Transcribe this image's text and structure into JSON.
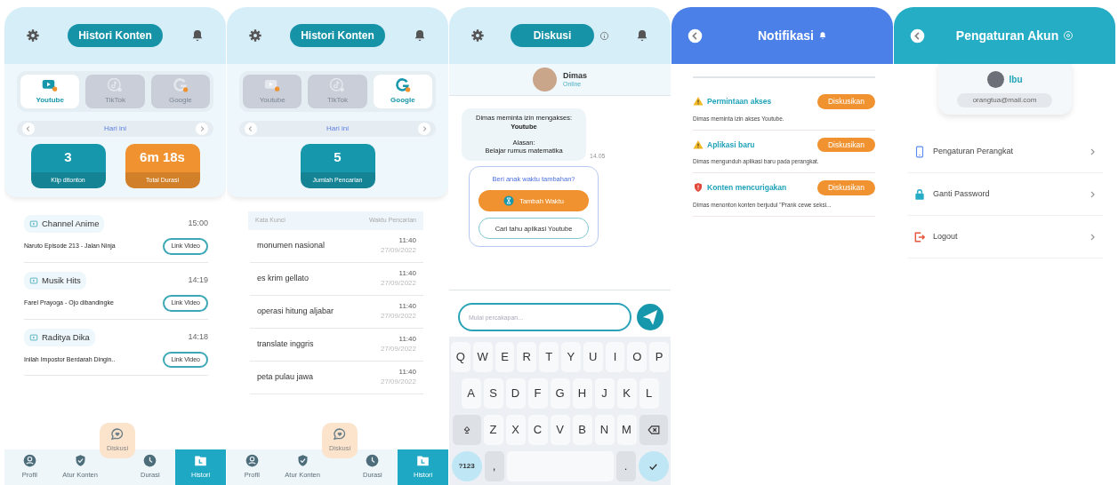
{
  "screens": [
    {
      "kind": "history",
      "title": "Histori Konten",
      "platforms": [
        {
          "label": "Youtube",
          "kind": "youtube",
          "selected": true
        },
        {
          "label": "TikTok",
          "kind": "tiktok",
          "selected": false
        },
        {
          "label": "Google",
          "kind": "google",
          "selected": false
        }
      ],
      "date_label": "Hari ini",
      "stats": [
        {
          "value": "3",
          "label": "Klip ditonton",
          "color": "#1797ab"
        },
        {
          "value": "6m 18s",
          "label": "Total Durasi",
          "color": "#f0922f"
        }
      ],
      "content": {
        "kind": "videos",
        "items": [
          {
            "channel": "Channel Anime",
            "time": "15:00",
            "title": "Naruto Episode 213 - Jalan Ninja",
            "button": "Link Video"
          },
          {
            "channel": "Musik Hits",
            "time": "14:19",
            "title": "Farel Prayoga - Ojo dibandingke",
            "button": "Link Video"
          },
          {
            "channel": "Raditya Dika",
            "time": "14:18",
            "title": "Inilah Impostor Berdarah Dingin..",
            "button": "Link Video"
          }
        ]
      },
      "fab_label": "Diskusi",
      "nav": [
        {
          "label": "Profil",
          "kind": "profile",
          "selected": false
        },
        {
          "label": "Atur Konten",
          "kind": "shield",
          "selected": false
        },
        {
          "label": "Durasi",
          "kind": "clock",
          "selected": false
        },
        {
          "label": "Histori",
          "kind": "folder",
          "selected": true
        }
      ]
    },
    {
      "kind": "history",
      "title": "Histori Konten",
      "platforms": [
        {
          "label": "Youtube",
          "kind": "youtube",
          "selected": false
        },
        {
          "label": "TikTok",
          "kind": "tiktok",
          "selected": false
        },
        {
          "label": "Google",
          "kind": "google",
          "selected": true
        }
      ],
      "date_label": "Hari ini",
      "stats": [
        {
          "value": "5",
          "label": "Jumlah Pencarian",
          "color": "#1797ab"
        }
      ],
      "content": {
        "kind": "searches",
        "columns": [
          "Kata Kunci",
          "Waktu Pencarian"
        ],
        "rows": [
          {
            "keyword": "monumen nasional",
            "time": "11:40",
            "date": "27/09/2022"
          },
          {
            "keyword": "es krim gellato",
            "time": "11:40",
            "date": "27/09/2022"
          },
          {
            "keyword": "operasi hitung aljabar",
            "time": "11:40",
            "date": "27/09/2022"
          },
          {
            "keyword": "translate inggris",
            "time": "11:40",
            "date": "27/09/2022"
          },
          {
            "keyword": "peta pulau jawa",
            "time": "11:40",
            "date": "27/09/2022"
          }
        ]
      },
      "fab_label": "Diskusi",
      "nav": [
        {
          "label": "Profil",
          "kind": "profile",
          "selected": false
        },
        {
          "label": "Atur Konten",
          "kind": "shield",
          "selected": false
        },
        {
          "label": "Durasi",
          "kind": "clock",
          "selected": false
        },
        {
          "label": "Histori",
          "kind": "folder",
          "selected": true
        }
      ]
    },
    {
      "kind": "chat",
      "title": "Diskusi",
      "contact": {
        "name": "Dimas",
        "status": "Online"
      },
      "message": {
        "intro": "Dimas meminta izin mengakses:",
        "app": "Youtube",
        "reason_label": "Alasan:",
        "reason": "Belajar rumus matematika",
        "time": "14.05"
      },
      "prompt": {
        "question": "Beri anak waktu tambahan?",
        "primary": "Tambah Waktu",
        "secondary": "Cari tahu aplikasi Youtube"
      },
      "input": {
        "placeholder": "Mulai percakapan..."
      },
      "keyboard": {
        "rows": [
          [
            "Q",
            "W",
            "E",
            "R",
            "T",
            "Y",
            "U",
            "I",
            "O",
            "P"
          ],
          [
            "A",
            "S",
            "D",
            "F",
            "G",
            "H",
            "J",
            "K",
            "L"
          ],
          [
            "Z",
            "X",
            "C",
            "V",
            "B",
            "N",
            "M"
          ]
        ],
        "symbols": "?123",
        "comma": ",",
        "period": "."
      }
    },
    {
      "kind": "notifications",
      "title": "Notifikasi",
      "items": [
        {
          "kind": "warning",
          "title": "Permintaan akses",
          "text": "Dimas meminta izin akses Youtube.",
          "action": "Diskusikan"
        },
        {
          "kind": "warning",
          "title": "Aplikasi baru",
          "text": "Dimas mengunduh aplikasi baru pada perangkat.",
          "action": "Diskusikan"
        },
        {
          "kind": "danger",
          "title": "Konten mencurigakan",
          "text": "Dimas menonton konten berjudul \"Prank cewe seksi...",
          "action": "Diskusikan"
        }
      ]
    },
    {
      "kind": "account",
      "title": "Pengaturan Akun",
      "profile": {
        "name": "Ibu",
        "email": "orangtua@mail.com"
      },
      "menu": [
        {
          "kind": "device",
          "label": "Pengaturan Perangkat"
        },
        {
          "kind": "lock",
          "label": "Ganti Password"
        },
        {
          "kind": "logout",
          "label": "Logout"
        }
      ]
    }
  ]
}
